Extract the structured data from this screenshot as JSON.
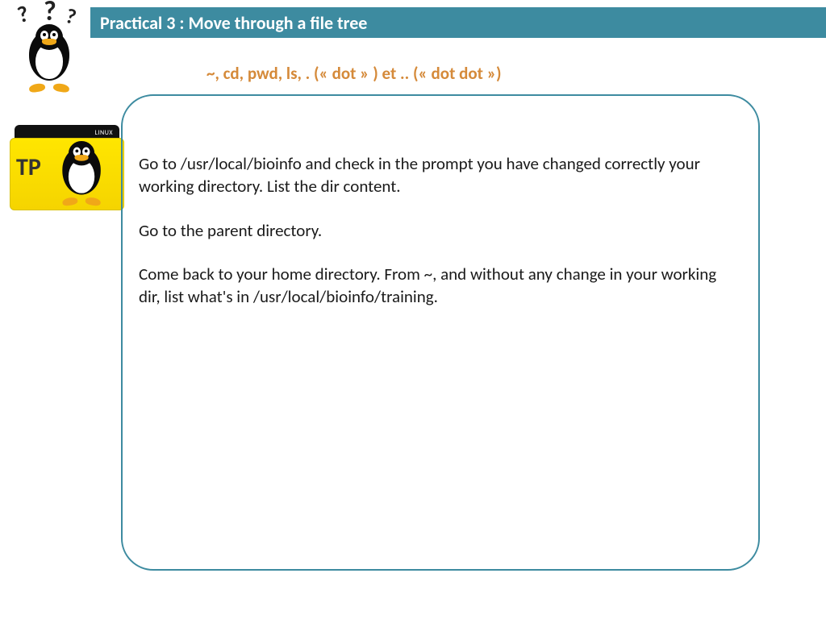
{
  "header": {
    "title": "Practical 3 : Move through a file tree"
  },
  "subtitle": "~, cd, pwd, ls, . (« dot » ) et .. (« dot dot »)",
  "tp": {
    "label": "TP",
    "tab": "LINUX"
  },
  "content": {
    "p1": "Go to /usr/local/bioinfo and check in the prompt you have changed correctly your working directory. List the dir content.",
    "p2": "Go to the parent directory.",
    "p3": "Come back to your home directory. From ~, and without any change in your working dir, list what's in /usr/local/bioinfo/training."
  }
}
